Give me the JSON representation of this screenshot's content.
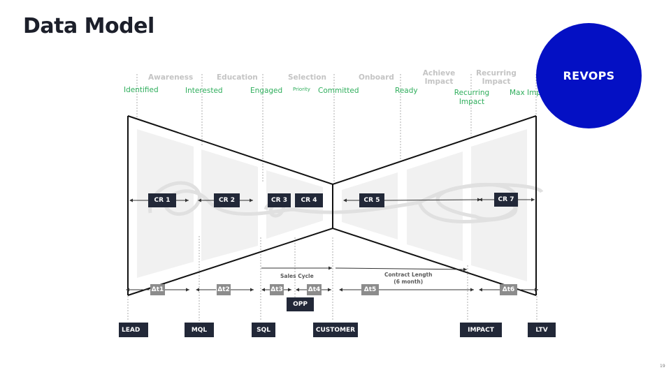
{
  "title": "Data Model",
  "badge": "REVOPS",
  "page_number": "19",
  "stages": [
    "Awareness",
    "Education",
    "Selection",
    "Onboard",
    "Achieve Impact",
    "Recurring Impact"
  ],
  "states": [
    "Identified",
    "Interested",
    "Engaged",
    "Priority",
    "Committed",
    "Ready",
    "Recurring Impact",
    "Max Impact"
  ],
  "conversion_rates": [
    "CR 1",
    "CR 2",
    "CR 3",
    "CR 4",
    "CR 5",
    "CR 7"
  ],
  "time_deltas": [
    "Δt1",
    "Δt2",
    "Δt3",
    "Δt4",
    "Δt5",
    "Δt6"
  ],
  "milestones": [
    "LEAD",
    "MQL",
    "SQL",
    "CUSTOMER",
    "IMPACT",
    "LTV"
  ],
  "opp_label": "OPP",
  "sales_cycle_label": "Sales Cycle",
  "contract_length_label": "Contract Length",
  "contract_length_sub": "(6 month)",
  "colors": {
    "accent": "#0410c4",
    "state_text": "#2fae5c",
    "dark_box": "#222838",
    "delta_box": "#8c8c8c"
  }
}
